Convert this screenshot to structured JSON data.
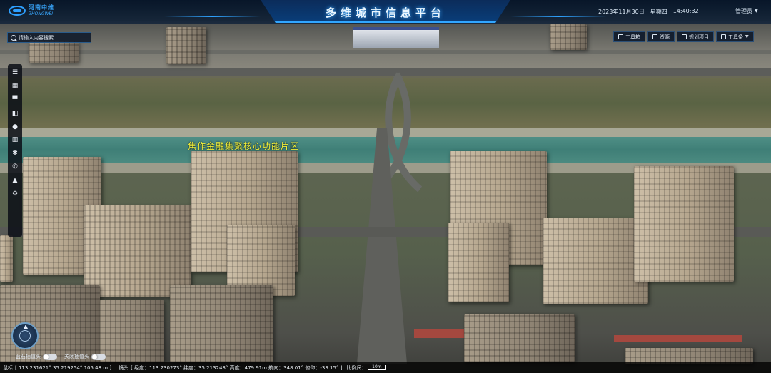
{
  "header": {
    "title": "多维城市信息平台",
    "logo_cn": "河南中维",
    "logo_en": "ZHONGWEI",
    "date": "2023年11月30日",
    "weekday": "星期四",
    "time": "14:40:32",
    "user_menu": "管理员"
  },
  "search": {
    "placeholder": "请输入内容搜索"
  },
  "toolbar": {
    "items": [
      {
        "label": "工具箱",
        "icon": "toolbox-icon"
      },
      {
        "label": "资源",
        "icon": "resource-icon"
      },
      {
        "label": "规划项目",
        "icon": "planning-icon"
      },
      {
        "label": "工具条",
        "icon": "toolbar-icon"
      }
    ]
  },
  "sidetools": {
    "icons": [
      "menu-icon",
      "layers-icon",
      "comment-icon",
      "layout-icon",
      "chat-icon",
      "chart-icon",
      "sun-icon",
      "phone-icon",
      "building-icon",
      "settings-icon"
    ]
  },
  "map": {
    "label": "焦作金融集聚核心功能片区"
  },
  "toggles": {
    "blue_sky": "蓝石插值头",
    "close_head": "关闭插值头"
  },
  "status": {
    "coords_label": "鼠标",
    "coords": "[ 113.231621°  35.219254°  105.48 m ]",
    "camera_label": "镜头",
    "camera": "[ 经度：113.230273°  纬度：35.213243°  高度：479.91m  航向：348.01°  俯仰：-33.15° ]",
    "scale_label": "比例尺：",
    "scale_value": "10m"
  },
  "colors": {
    "accent": "#2fa2ff",
    "label": "#f3ef38",
    "header_bg": "#0a1a30"
  }
}
